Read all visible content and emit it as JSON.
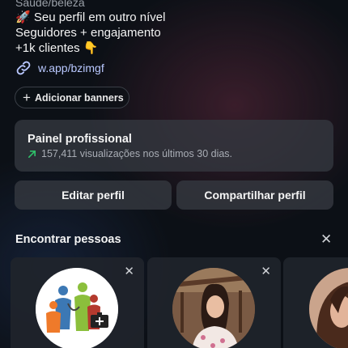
{
  "bio": {
    "category": "Saúde/beleza",
    "line1": "🚀 Seu perfil em outro nível",
    "line2": "Seguidores + engajamento",
    "line3": "+1k clientes 👇",
    "link": "w.app/bzimgf"
  },
  "banners_button": {
    "label": "Adicionar banners"
  },
  "professional_panel": {
    "title": "Painel profissional",
    "stats": "157,411 visualizações nos últimos 30 dias."
  },
  "actions": {
    "edit_label": "Editar perfil",
    "share_label": "Compartilhar perfil"
  },
  "discover": {
    "title": "Encontrar pessoas",
    "cards": [
      {
        "avatar": "medical-team-logo"
      },
      {
        "avatar": "woman-portrait"
      },
      {
        "avatar": "woman-portrait-partial"
      }
    ]
  },
  "icons": {
    "link": "link-icon",
    "close": "close-icon",
    "plus": "plus-icon",
    "trend": "trend-up-icon"
  },
  "colors": {
    "background": "#0c1016",
    "surface": "#343840",
    "link": "#b9c8ff",
    "trend": "#2fc06a"
  }
}
